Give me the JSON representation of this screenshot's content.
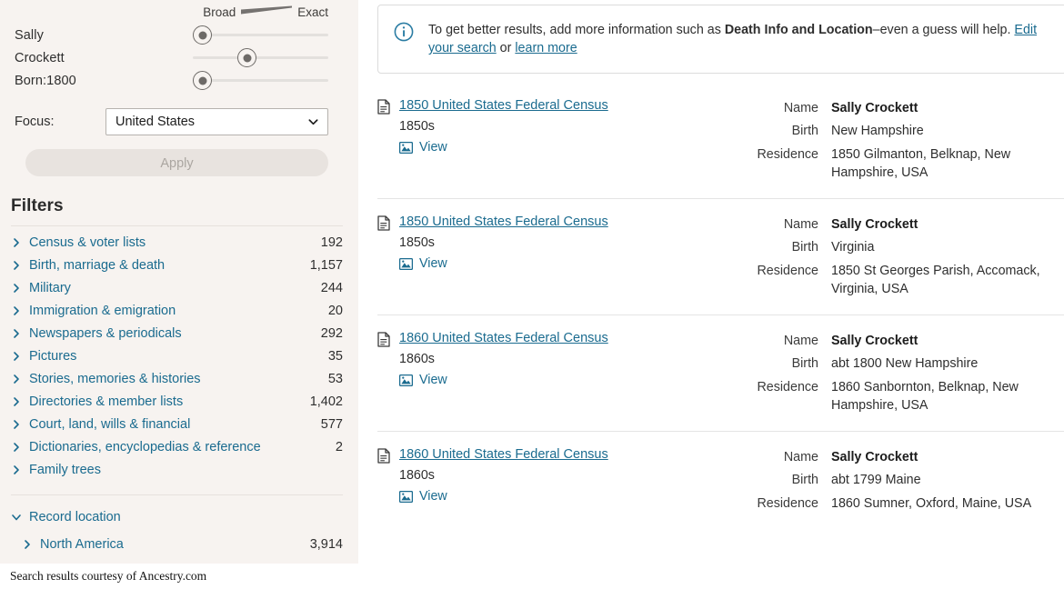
{
  "sidebar": {
    "slider_scale": {
      "broad_label": "Broad",
      "exact_label": "Exact"
    },
    "sliders": [
      {
        "label": "Sally",
        "position_pct": 13
      },
      {
        "label": "Crockett",
        "position_pct": 42
      },
      {
        "label": "Born:1800",
        "position_pct": 13
      }
    ],
    "focus": {
      "label": "Focus:",
      "value": "United States",
      "options": [
        "United States"
      ]
    },
    "apply_label": "Apply",
    "filters_heading": "Filters",
    "filters": [
      {
        "label": "Census & voter lists",
        "count": "192"
      },
      {
        "label": "Birth, marriage & death",
        "count": "1,157"
      },
      {
        "label": "Military",
        "count": "244"
      },
      {
        "label": "Immigration & emigration",
        "count": "20"
      },
      {
        "label": "Newspapers & periodicals",
        "count": "292"
      },
      {
        "label": "Pictures",
        "count": "35"
      },
      {
        "label": "Stories, memories & histories",
        "count": "53"
      },
      {
        "label": "Directories & member lists",
        "count": "1,402"
      },
      {
        "label": "Court, land, wills & financial",
        "count": "577"
      },
      {
        "label": "Dictionaries, encyclopedias & reference",
        "count": "2"
      },
      {
        "label": "Family trees",
        "count": ""
      }
    ],
    "record_location": {
      "label": "Record location",
      "children": [
        {
          "label": "North America",
          "count": "3,914"
        }
      ]
    }
  },
  "main": {
    "banner": {
      "lead": "To get better results, add more information such as ",
      "strong": "Death Info and Location",
      "after_strong": "–even a guess will help. ",
      "link1": "Edit your search",
      "between": " or ",
      "link2": "learn more"
    },
    "field_labels": {
      "name": "Name",
      "birth": "Birth",
      "residence": "Residence"
    },
    "view_label": "View",
    "results": [
      {
        "title": "1850 United States Federal Census",
        "decade": "1850s",
        "name": "Sally Crockett",
        "birth": "New Hampshire",
        "residence": "1850 Gilmanton, Belknap, New Hampshire, USA"
      },
      {
        "title": "1850 United States Federal Census",
        "decade": "1850s",
        "name": "Sally Crockett",
        "birth": "Virginia",
        "residence": "1850 St Georges Parish, Accomack, Virginia, USA"
      },
      {
        "title": "1860 United States Federal Census",
        "decade": "1860s",
        "name": "Sally Crockett",
        "birth": "abt 1800 New Hampshire",
        "residence": "1860 Sanbornton, Belknap, New Hampshire, USA"
      },
      {
        "title": "1860 United States Federal Census",
        "decade": "1860s",
        "name": "Sally Crockett",
        "birth": "abt 1799 Maine",
        "residence": "1860 Sumner, Oxford, Maine, USA"
      }
    ]
  },
  "footer": {
    "text": "Search results courtesy of Ancestry.com"
  },
  "colors": {
    "link": "#1a6b8f",
    "sidebar_bg": "#f7f3f0",
    "content_bg": "#ffffff",
    "divider": "#e4e4e4"
  }
}
